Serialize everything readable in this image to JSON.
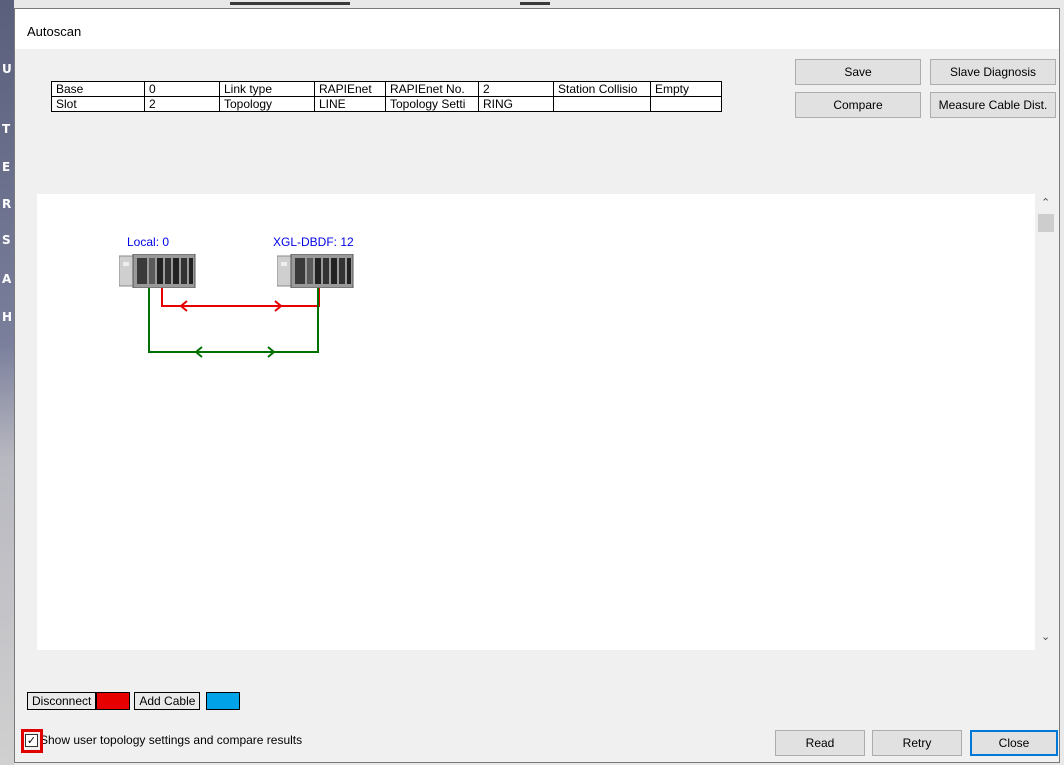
{
  "window": {
    "title": "Autoscan"
  },
  "background_app": {
    "letters": [
      "U",
      "T",
      "E",
      "R",
      "S",
      "A",
      "H"
    ]
  },
  "info_table": {
    "rows": [
      [
        "Base",
        "0",
        "Link type",
        "RAPIEnet",
        "RAPIEnet No.",
        "2",
        "Station Collisio",
        "Empty"
      ],
      [
        "Slot",
        "2",
        "Topology",
        "LINE",
        "Topology Setti",
        "RING",
        "",
        ""
      ]
    ]
  },
  "buttons": {
    "save": "Save",
    "slave_diagnosis": "Slave Diagnosis",
    "compare": "Compare",
    "measure_cable": "Measure Cable Dist.",
    "read": "Read",
    "retry": "Retry",
    "close": "Close"
  },
  "topology": {
    "nodes": [
      {
        "label": "Local: 0"
      },
      {
        "label": "XGL-DBDF: 12"
      }
    ],
    "links": [
      {
        "color": "#e60000",
        "status": "disconnect"
      },
      {
        "color": "#007000",
        "status": "connected"
      }
    ]
  },
  "legend": {
    "items": [
      {
        "label": "Disconnect",
        "color": "#e60000"
      },
      {
        "label": "Add Cable",
        "color": "#00a2e8"
      }
    ]
  },
  "options": {
    "show_user_topology": {
      "label": "Show user topology settings and compare results",
      "checked": true,
      "check_glyph": "✓"
    }
  },
  "scrollbar": {
    "up": "⌃",
    "down": "⌄"
  }
}
